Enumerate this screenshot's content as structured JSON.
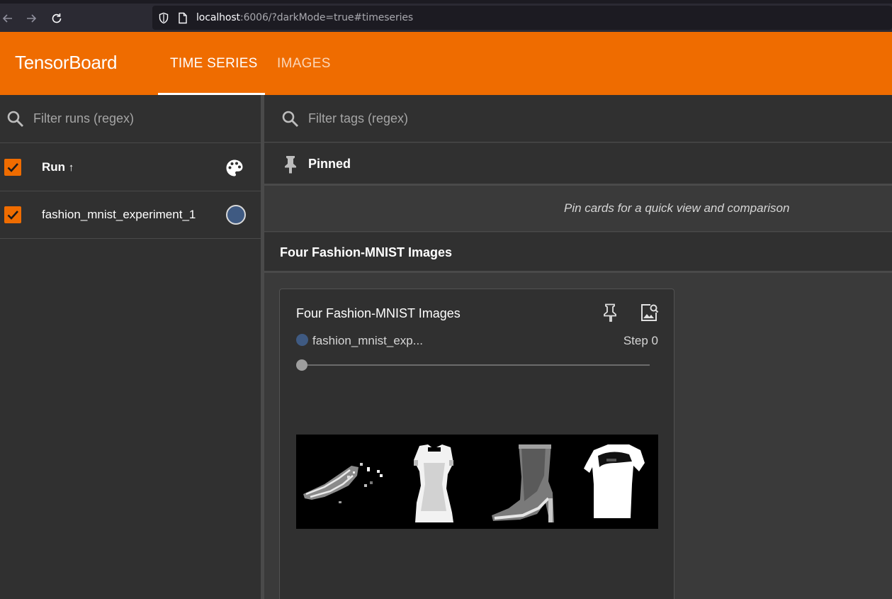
{
  "browser": {
    "url_host": "localhost",
    "url_rest": ":6006/?darkMode=true#timeseries"
  },
  "header": {
    "brand": "TensorBoard",
    "tabs": [
      {
        "label": "TIME SERIES",
        "active": true
      },
      {
        "label": "IMAGES",
        "active": false
      }
    ]
  },
  "sidebar": {
    "filter_placeholder": "Filter runs (regex)",
    "run_header_label": "Run",
    "sort_arrow": "↑",
    "runs": [
      {
        "name": "fashion_mnist_experiment_1",
        "checked": true,
        "color": "#3f5a82"
      }
    ]
  },
  "main": {
    "filter_placeholder": "Filter tags (regex)",
    "pinned_label": "Pinned",
    "pinned_hint": "Pin cards for a quick view and comparison",
    "group_title": "Four Fashion-MNIST Images",
    "card": {
      "title": "Four Fashion-MNIST Images",
      "run_name": "fashion_mnist_exp...",
      "step_label": "Step 0",
      "run_color": "#3f5a82",
      "image_items": [
        "sandal",
        "dress",
        "ankle-boot",
        "top"
      ]
    }
  },
  "colors": {
    "accent": "#ef6c00",
    "background": "#303030"
  }
}
